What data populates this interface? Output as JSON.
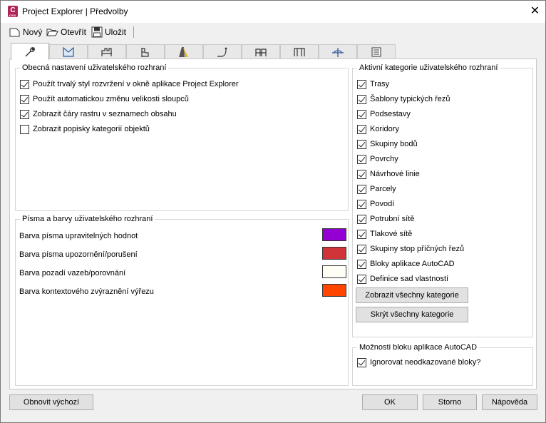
{
  "window": {
    "title": "Project Explorer | Předvolby",
    "app_icon_letter": "C",
    "app_icon_sub": "CIVIL"
  },
  "toolbar": {
    "new_label": "Nový",
    "open_label": "Otevřít",
    "save_label": "Uložit"
  },
  "tabs": [
    {
      "icon": "wrench-icon",
      "active": true
    },
    {
      "icon": "surface-icon"
    },
    {
      "icon": "assembly-icon"
    },
    {
      "icon": "profile-flag-icon"
    },
    {
      "icon": "corridor-road-icon"
    },
    {
      "icon": "alignment-curve-icon"
    },
    {
      "icon": "subassembly-icon"
    },
    {
      "icon": "subassembly-alt-icon"
    },
    {
      "icon": "section-icon"
    },
    {
      "icon": "report-list-icon"
    }
  ],
  "general": {
    "title": "Obecná nastavení uživatelského rozhraní",
    "items": [
      {
        "label": "Použít trvalý styl rozvržení v okně aplikace Project Explorer",
        "checked": true
      },
      {
        "label": "Použít automatickou změnu velikosti sloupců",
        "checked": true
      },
      {
        "label": "Zobrazit čáry rastru v seznamech obsahu",
        "checked": true
      },
      {
        "label": "Zobrazit popisky kategorií objektů",
        "checked": false
      }
    ]
  },
  "fonts": {
    "title": "Písma a barvy uživatelského rozhraní",
    "rows": [
      {
        "label": "Barva písma upravitelných hodnot",
        "color": "#9400d3"
      },
      {
        "label": "Barva písma upozornění/porušení",
        "color": "#d13438"
      },
      {
        "label": "Barva pozadí vazeb/porovnání",
        "color": "#fffef4"
      },
      {
        "label": "Barva kontextového zvýraznění výřezu",
        "color": "#ff4500"
      }
    ]
  },
  "categories": {
    "title": "Aktivní kategorie uživatelského rozhraní",
    "items": [
      {
        "label": "Trasy",
        "checked": true
      },
      {
        "label": "Šablony typických řezů",
        "checked": true
      },
      {
        "label": "Podsestavy",
        "checked": true
      },
      {
        "label": "Koridory",
        "checked": true
      },
      {
        "label": "Skupiny bodů",
        "checked": true
      },
      {
        "label": "Povrchy",
        "checked": true
      },
      {
        "label": "Návrhové linie",
        "checked": true
      },
      {
        "label": "Parcely",
        "checked": true
      },
      {
        "label": "Povodí",
        "checked": true
      },
      {
        "label": "Potrubní sítě",
        "checked": true
      },
      {
        "label": "Tlakové sítě",
        "checked": true
      },
      {
        "label": "Skupiny stop příčných řezů",
        "checked": true
      },
      {
        "label": "Bloky aplikace AutoCAD",
        "checked": true
      },
      {
        "label": "Definice sad vlastností",
        "checked": true
      }
    ],
    "show_all_label": "Zobrazit všechny kategorie",
    "hide_all_label": "Skrýt všechny kategorie"
  },
  "blocks": {
    "title": "Možnosti bloku aplikace AutoCAD",
    "ignore_label": "Ignorovat neodkazované bloky?",
    "ignore_checked": true
  },
  "footer": {
    "restore_label": "Obnovit výchozí",
    "ok_label": "OK",
    "cancel_label": "Storno",
    "help_label": "Nápověda"
  }
}
